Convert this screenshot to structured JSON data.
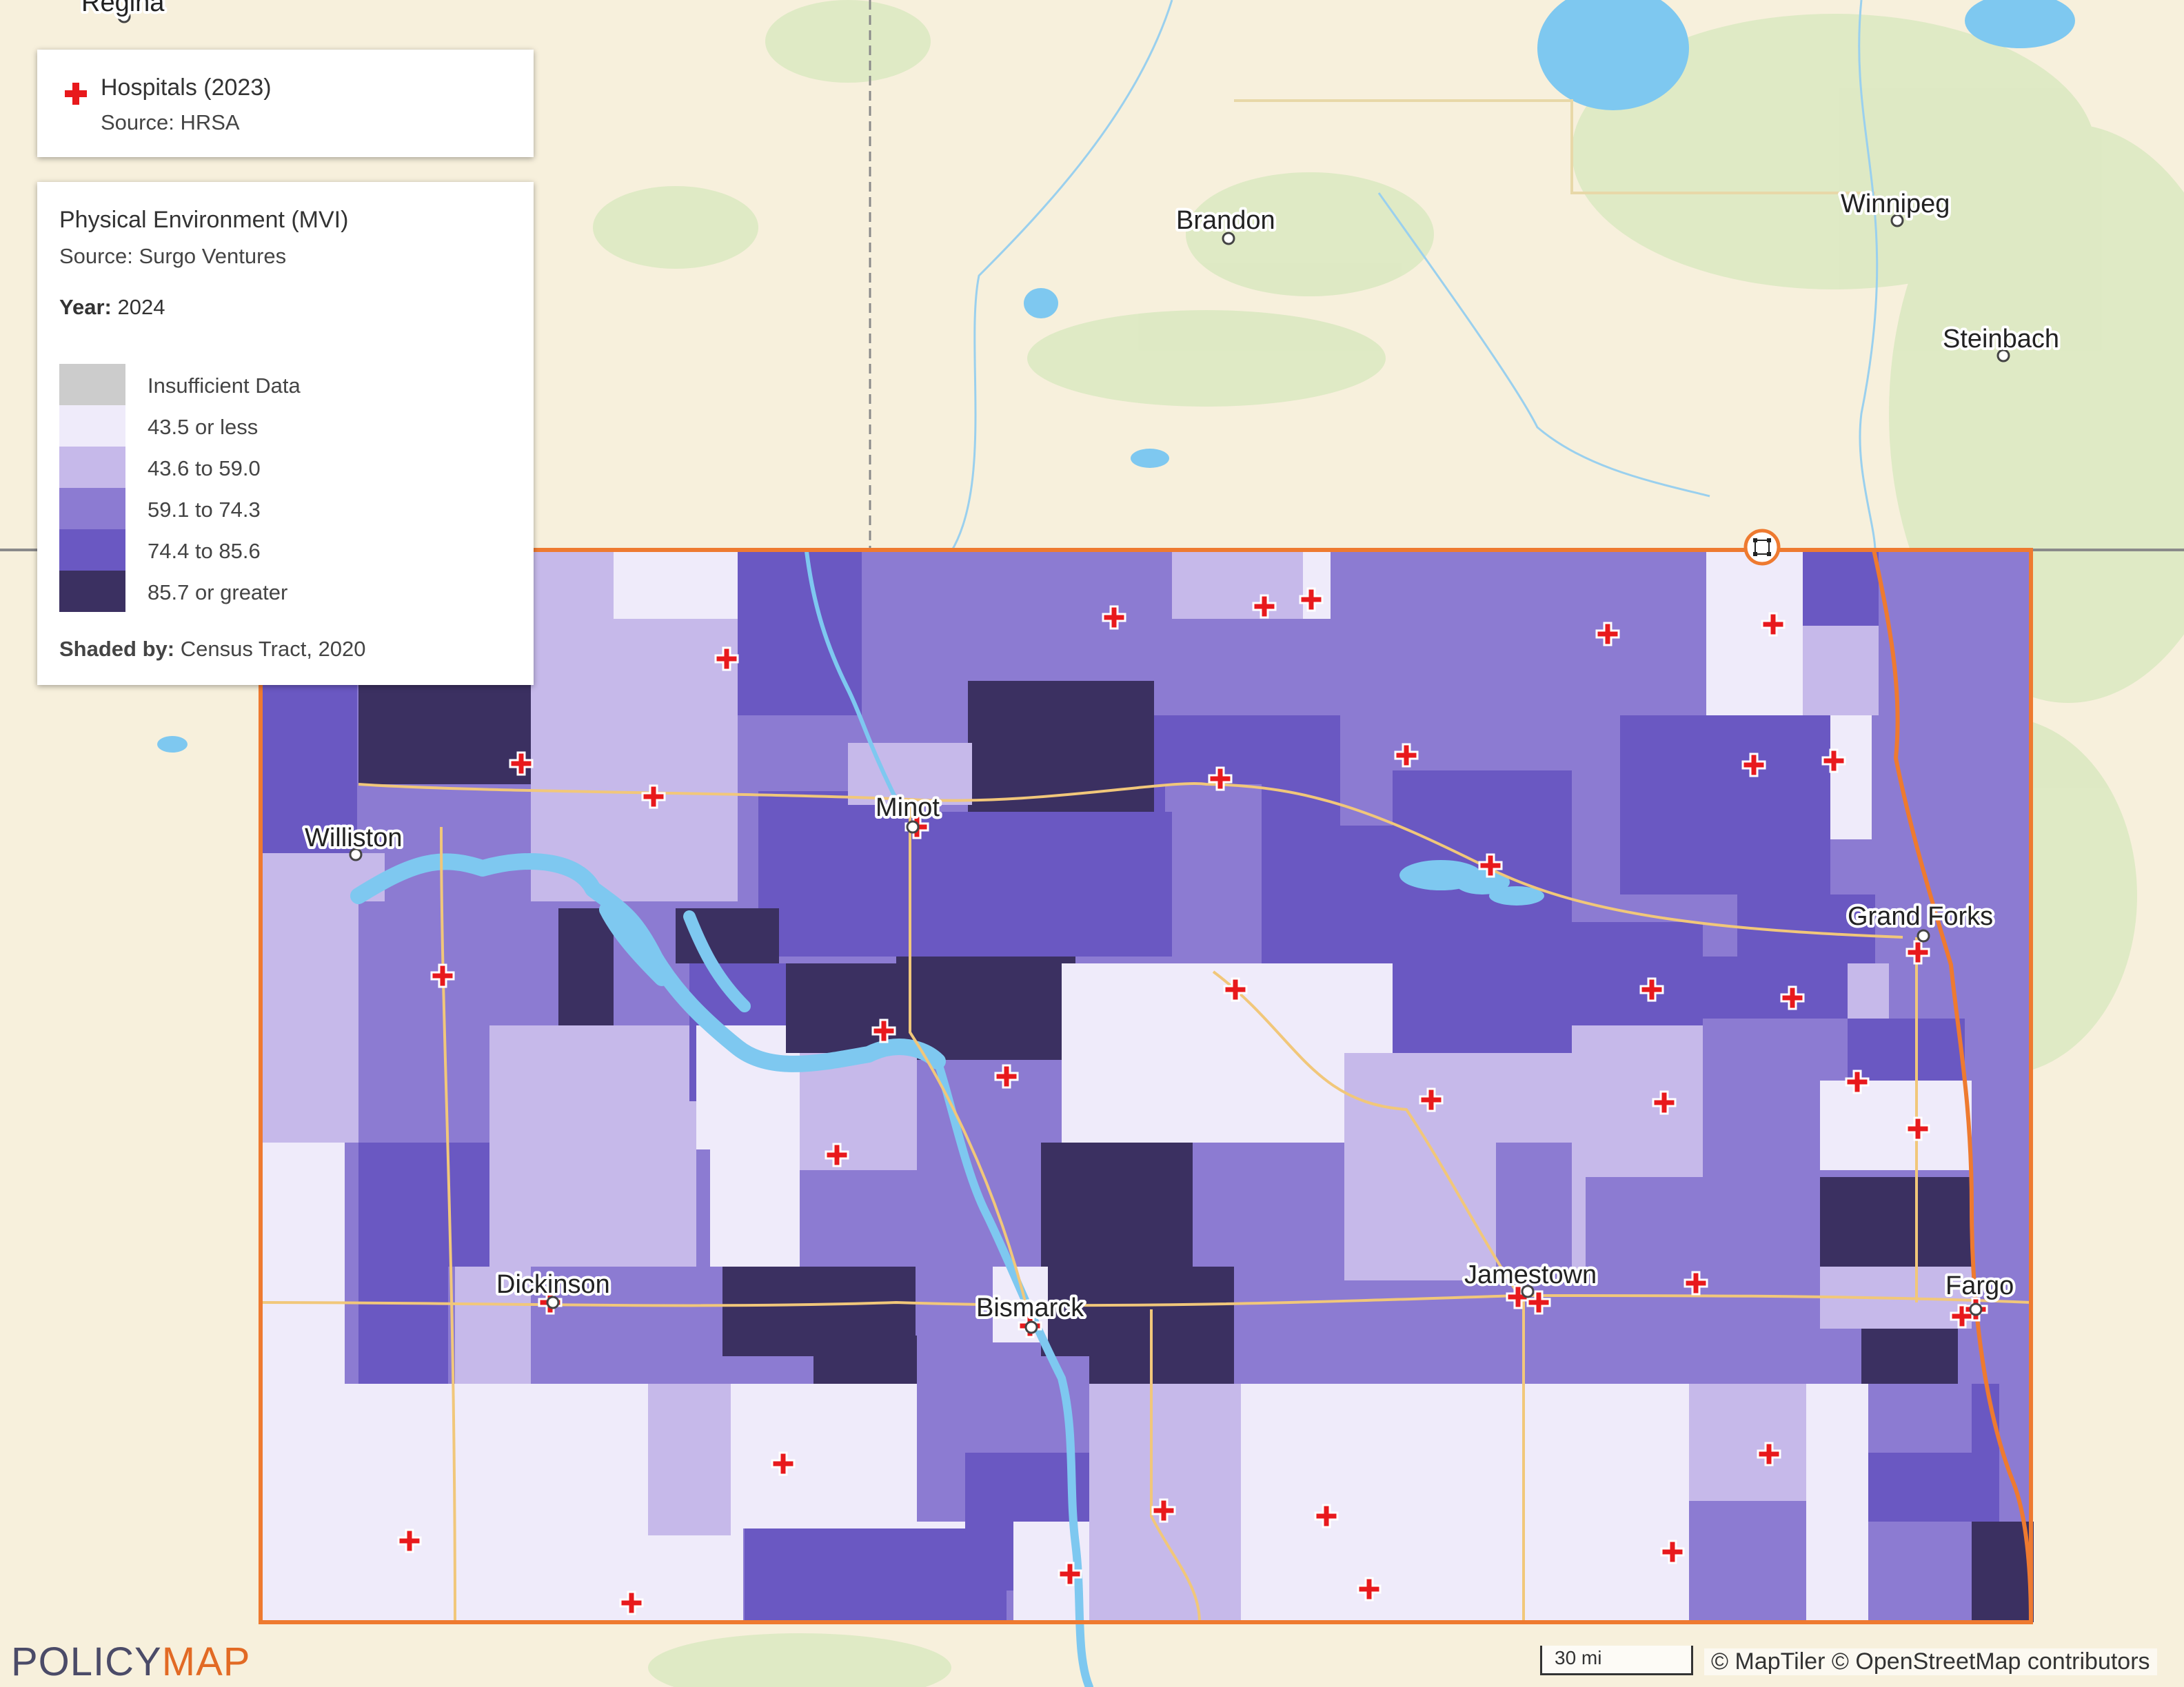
{
  "hospital_legend": {
    "title": "Hospitals (2023)",
    "source": "Source: HRSA"
  },
  "mvi_legend": {
    "title": "Physical Environment (MVI)",
    "source": "Source: Surgo Ventures",
    "year_label": "Year:",
    "year_value": "2024",
    "bins": [
      {
        "label": "Insufficient Data",
        "color": "#cccccc"
      },
      {
        "label": "43.5 or less",
        "color": "#efebfa"
      },
      {
        "label": "43.6 to 59.0",
        "color": "#c6b9ea"
      },
      {
        "label": "59.1 to 74.3",
        "color": "#8c7bd2"
      },
      {
        "label": "74.4 to 85.6",
        "color": "#6a58c2"
      },
      {
        "label": "85.7 or greater",
        "color": "#3b3061"
      }
    ],
    "shaded_label": "Shaded by:",
    "shaded_value": "Census Tract, 2020"
  },
  "cities": {
    "regina": "Regina",
    "brandon": "Brandon",
    "winnipeg": "Winnipeg",
    "steinbach": "Steinbach",
    "williston": "Williston",
    "minot": "Minot",
    "grand_forks": "Grand Forks",
    "dickinson": "Dickinson",
    "bismarck": "Bismarck",
    "jamestown": "Jamestown",
    "fargo": "Fargo"
  },
  "scale_label": "30 mi",
  "attribution": "© MapTiler © OpenStreetMap contributors",
  "logo": {
    "part1": "POLICY",
    "part2": "MAP"
  },
  "colors": {
    "hospital": "#e8191c",
    "state_border": "#ee7a30",
    "water": "#7ec8f0",
    "background": "#f7f0dc"
  },
  "icons": {
    "hospital": "red-cross-icon",
    "fullscreen": "fullscreen-icon"
  }
}
